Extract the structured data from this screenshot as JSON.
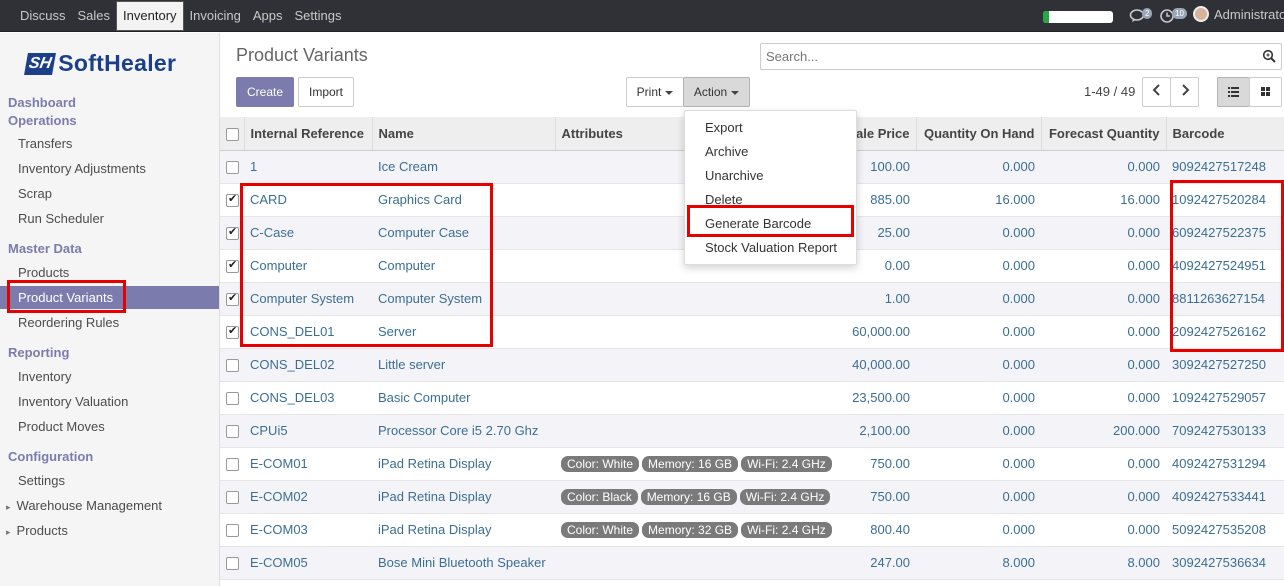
{
  "topbar": {
    "menu": [
      "Discuss",
      "Sales",
      "Inventory",
      "Invoicing",
      "Apps",
      "Settings"
    ],
    "active": "Inventory",
    "chat_count": "2",
    "activity_count": "10",
    "user": "Administrator",
    "progress_fraction": 0.08
  },
  "sidebar": {
    "logo_mark": "SH",
    "logo_text": "SoftHealer",
    "sections": [
      {
        "title": "Dashboard Operations",
        "items": [
          "Transfers",
          "Inventory Adjustments",
          "Scrap",
          "Run Scheduler"
        ]
      },
      {
        "title": "Master Data",
        "items": [
          "Products",
          "Product Variants",
          "Reordering Rules"
        ]
      },
      {
        "title": "Reporting",
        "items": [
          "Inventory",
          "Inventory Valuation",
          "Product Moves"
        ]
      },
      {
        "title": "Configuration",
        "items": [
          "Settings",
          "Warehouse Management",
          "Products"
        ]
      }
    ],
    "active_item": "Product Variants"
  },
  "control_panel": {
    "title": "Product Variants",
    "search_placeholder": "Search...",
    "create": "Create",
    "import": "Import",
    "print": "Print",
    "action": "Action",
    "pager": "1-49 / 49"
  },
  "action_menu": [
    "Export",
    "Archive",
    "Unarchive",
    "Delete",
    "Generate Barcode",
    "Stock Valuation Report"
  ],
  "table": {
    "columns": [
      "Internal Reference",
      "Name",
      "Attributes",
      "Sale Price",
      "Quantity On Hand",
      "Forecast Quantity",
      "Barcode"
    ],
    "rows": [
      {
        "checked": false,
        "ref": "1",
        "name": "Ice Cream",
        "tags": [],
        "price": "100.00",
        "onhand": "0.000",
        "forecast": "0.000",
        "barcode": "9092427517248"
      },
      {
        "checked": true,
        "ref": "CARD",
        "name": "Graphics Card",
        "tags": [],
        "price": "885.00",
        "onhand": "16.000",
        "forecast": "16.000",
        "barcode": "1092427520284"
      },
      {
        "checked": true,
        "ref": "C-Case",
        "name": "Computer Case",
        "tags": [],
        "price": "25.00",
        "onhand": "0.000",
        "forecast": "0.000",
        "barcode": "6092427522375"
      },
      {
        "checked": true,
        "ref": "Computer",
        "name": "Computer",
        "tags": [],
        "price": "0.00",
        "onhand": "0.000",
        "forecast": "0.000",
        "barcode": "4092427524951"
      },
      {
        "checked": true,
        "ref": "Computer System",
        "name": "Computer System",
        "tags": [],
        "price": "1.00",
        "onhand": "0.000",
        "forecast": "0.000",
        "barcode": "8811263627154"
      },
      {
        "checked": true,
        "ref": "CONS_DEL01",
        "name": "Server",
        "tags": [],
        "price": "60,000.00",
        "onhand": "0.000",
        "forecast": "0.000",
        "barcode": "2092427526162"
      },
      {
        "checked": false,
        "ref": "CONS_DEL02",
        "name": "Little server",
        "tags": [],
        "price": "40,000.00",
        "onhand": "0.000",
        "forecast": "0.000",
        "barcode": "3092427527250"
      },
      {
        "checked": false,
        "ref": "CONS_DEL03",
        "name": "Basic Computer",
        "tags": [],
        "price": "23,500.00",
        "onhand": "0.000",
        "forecast": "0.000",
        "barcode": "1092427529057"
      },
      {
        "checked": false,
        "ref": "CPUi5",
        "name": "Processor Core i5 2.70 Ghz",
        "tags": [],
        "price": "2,100.00",
        "onhand": "0.000",
        "forecast": "200.000",
        "barcode": "7092427530133"
      },
      {
        "checked": false,
        "ref": "E-COM01",
        "name": "iPad Retina Display",
        "tags": [
          "Color: White",
          "Memory: 16 GB",
          "Wi-Fi: 2.4 GHz"
        ],
        "price": "750.00",
        "onhand": "0.000",
        "forecast": "0.000",
        "barcode": "4092427531294"
      },
      {
        "checked": false,
        "ref": "E-COM02",
        "name": "iPad Retina Display",
        "tags": [
          "Color: Black",
          "Memory: 16 GB",
          "Wi-Fi: 2.4 GHz"
        ],
        "price": "750.00",
        "onhand": "0.000",
        "forecast": "0.000",
        "barcode": "4092427533441"
      },
      {
        "checked": false,
        "ref": "E-COM03",
        "name": "iPad Retina Display",
        "tags": [
          "Color: White",
          "Memory: 32 GB",
          "Wi-Fi: 2.4 GHz"
        ],
        "price": "800.40",
        "onhand": "0.000",
        "forecast": "0.000",
        "barcode": "5092427535208"
      },
      {
        "checked": false,
        "ref": "E-COM05",
        "name": "Bose Mini Bluetooth Speaker",
        "tags": [],
        "price": "247.00",
        "onhand": "8.000",
        "forecast": "8.000",
        "barcode": "3092427536634"
      }
    ]
  },
  "colors": {
    "accent": "#7c7bad",
    "highlight": "#e60000",
    "topbar": "#2f3136",
    "link": "#3b6e93"
  }
}
